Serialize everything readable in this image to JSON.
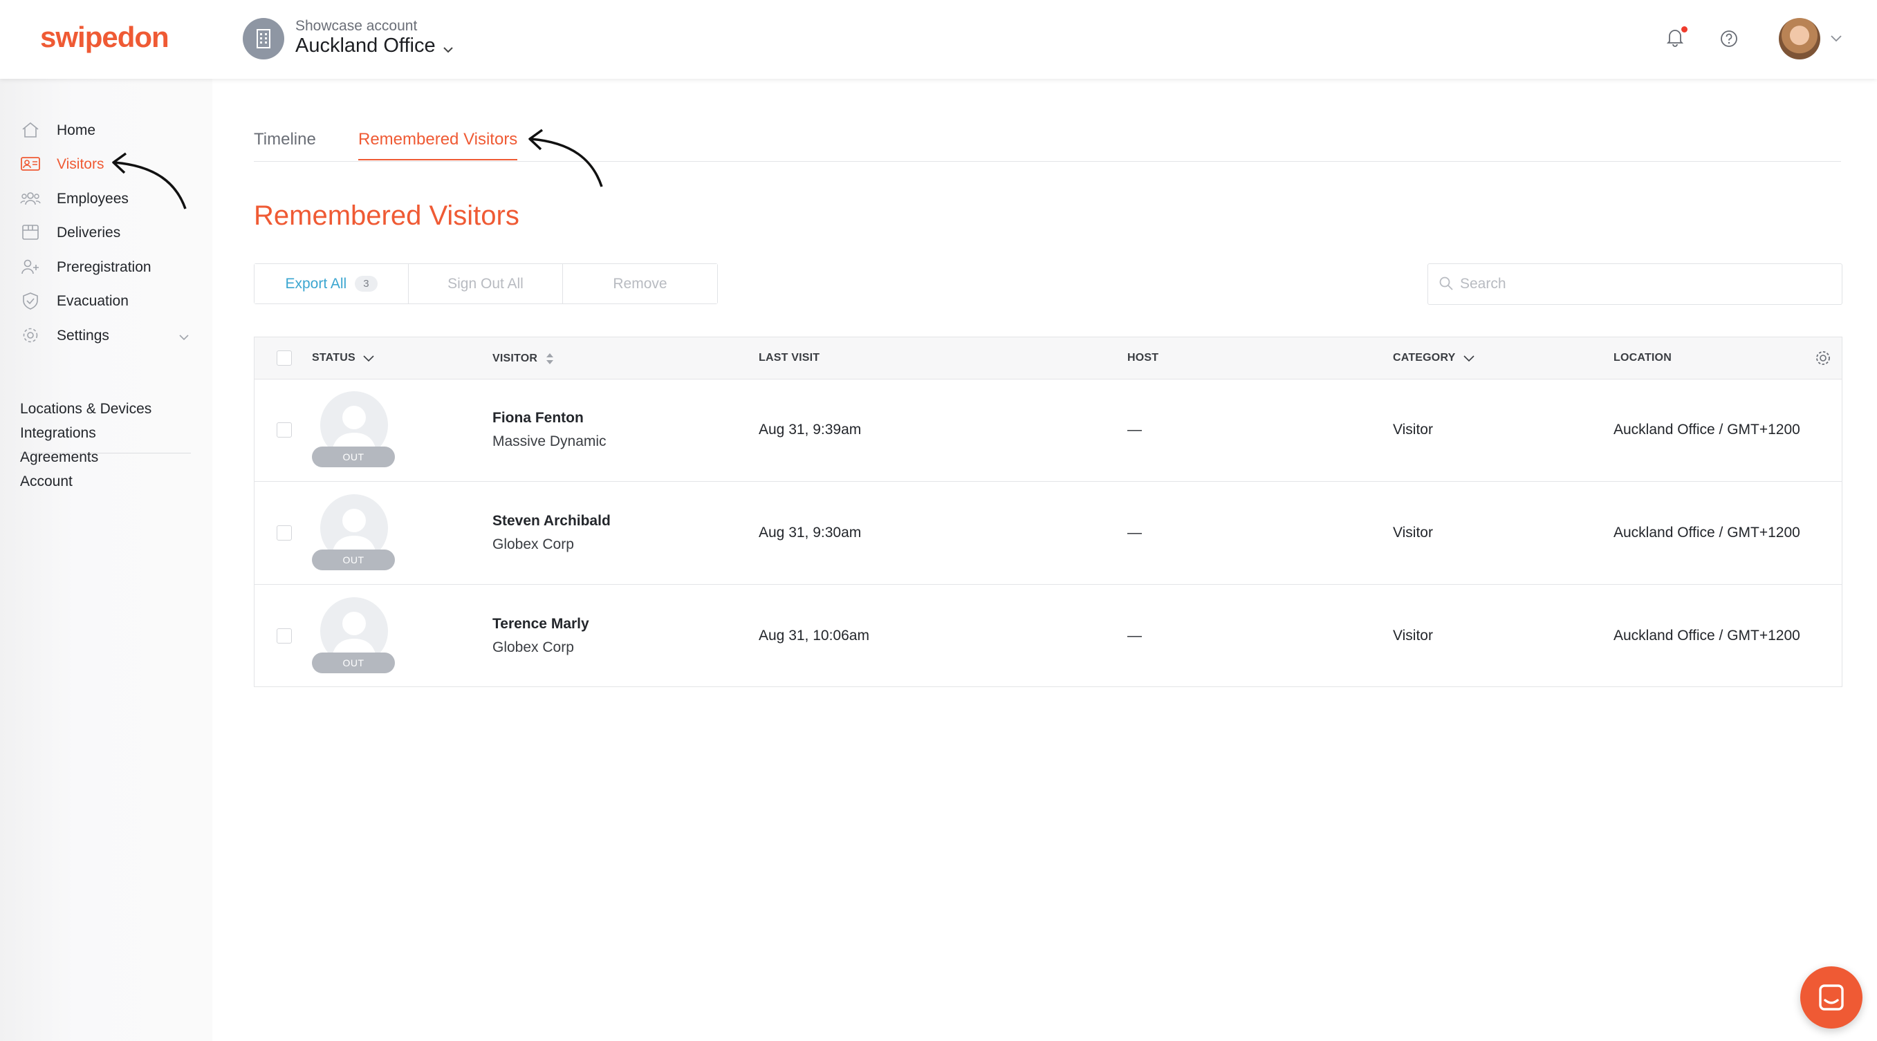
{
  "header": {
    "logo": "swipedon",
    "account_label": "Showcase account",
    "location_name": "Auckland Office"
  },
  "sidebar": {
    "items": [
      {
        "label": "Home",
        "icon": "home-icon"
      },
      {
        "label": "Visitors",
        "icon": "visitor-card-icon",
        "active": true
      },
      {
        "label": "Employees",
        "icon": "employees-icon"
      },
      {
        "label": "Deliveries",
        "icon": "package-icon"
      },
      {
        "label": "Preregistration",
        "icon": "user-plus-icon"
      },
      {
        "label": "Evacuation",
        "icon": "shield-icon"
      },
      {
        "label": "Settings",
        "icon": "gear-icon",
        "expandable": true
      }
    ],
    "links": [
      "Locations & Devices",
      "Integrations",
      "Agreements",
      "Account"
    ]
  },
  "tabs": [
    {
      "label": "Timeline",
      "active": false
    },
    {
      "label": "Remembered Visitors",
      "active": true
    }
  ],
  "page_title": "Remembered Visitors",
  "toolbar": {
    "export_label": "Export All",
    "export_count": "3",
    "sign_out_label": "Sign Out All",
    "remove_label": "Remove"
  },
  "search": {
    "placeholder": "Search",
    "value": ""
  },
  "table": {
    "columns": {
      "status": "STATUS",
      "visitor": "VISITOR",
      "last_visit": "LAST VISIT",
      "host": "HOST",
      "category": "CATEGORY",
      "location": "LOCATION"
    },
    "rows": [
      {
        "status": "OUT",
        "name": "Fiona Fenton",
        "company": "Massive Dynamic",
        "last_visit": "Aug 31, 9:39am",
        "host": "—",
        "category": "Visitor",
        "location": "Auckland Office / GMT+1200"
      },
      {
        "status": "OUT",
        "name": "Steven Archibald",
        "company": "Globex Corp",
        "last_visit": "Aug 31, 9:30am",
        "host": "—",
        "category": "Visitor",
        "location": "Auckland Office / GMT+1200"
      },
      {
        "status": "OUT",
        "name": "Terence Marly",
        "company": "Globex Corp",
        "last_visit": "Aug 31, 10:06am",
        "host": "—",
        "category": "Visitor",
        "location": "Auckland Office / GMT+1200"
      }
    ]
  },
  "colors": {
    "brand": "#ef5a34",
    "link": "#3ba6d0",
    "muted": "#b8bbc1"
  }
}
